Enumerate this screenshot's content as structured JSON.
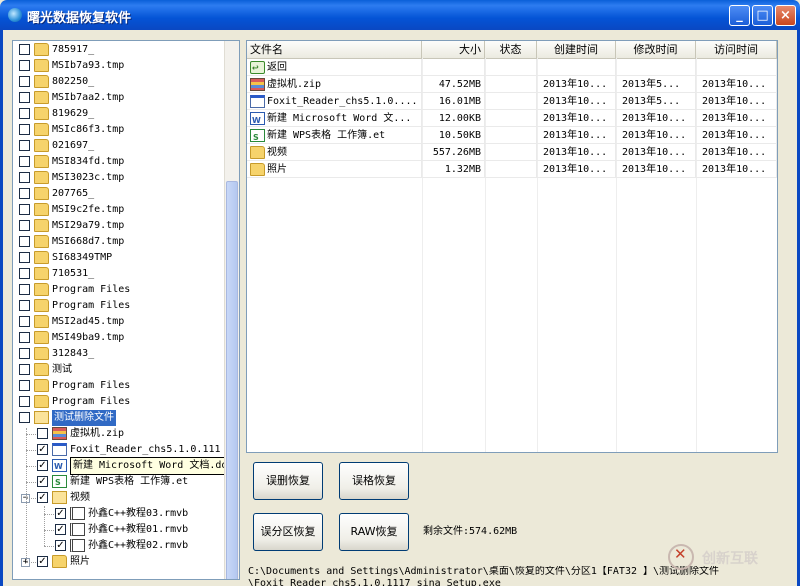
{
  "window": {
    "title": "曙光数据恢复软件"
  },
  "tree": {
    "items": [
      {
        "label": "785917_",
        "checked": false,
        "type": "folder",
        "level": 0
      },
      {
        "label": "MSIb7a93.tmp",
        "checked": false,
        "type": "folder",
        "level": 0
      },
      {
        "label": "802250_",
        "checked": false,
        "type": "folder",
        "level": 0
      },
      {
        "label": "MSIb7aa2.tmp",
        "checked": false,
        "type": "folder",
        "level": 0
      },
      {
        "label": "819629_",
        "checked": false,
        "type": "folder",
        "level": 0
      },
      {
        "label": "MSIc86f3.tmp",
        "checked": false,
        "type": "folder",
        "level": 0
      },
      {
        "label": "021697_",
        "checked": false,
        "type": "folder",
        "level": 0
      },
      {
        "label": "MSI834fd.tmp",
        "checked": false,
        "type": "folder",
        "level": 0
      },
      {
        "label": "MSI3023c.tmp",
        "checked": false,
        "type": "folder",
        "level": 0
      },
      {
        "label": "207765_",
        "checked": false,
        "type": "folder",
        "level": 0
      },
      {
        "label": "MSI9c2fe.tmp",
        "checked": false,
        "type": "folder",
        "level": 0
      },
      {
        "label": "MSI29a79.tmp",
        "checked": false,
        "type": "folder",
        "level": 0
      },
      {
        "label": "MSI668d7.tmp",
        "checked": false,
        "type": "folder",
        "level": 0
      },
      {
        "label": "SI68349TMP",
        "checked": false,
        "type": "folder",
        "level": 0
      },
      {
        "label": "710531_",
        "checked": false,
        "type": "folder",
        "level": 0
      },
      {
        "label": "Program Files",
        "checked": false,
        "type": "folder",
        "level": 0
      },
      {
        "label": "Program Files",
        "checked": false,
        "type": "folder",
        "level": 0
      },
      {
        "label": "MSI2ad45.tmp",
        "checked": false,
        "type": "folder",
        "level": 0
      },
      {
        "label": "MSI49ba9.tmp",
        "checked": false,
        "type": "folder",
        "level": 0
      },
      {
        "label": "312843_",
        "checked": false,
        "type": "folder",
        "level": 0
      },
      {
        "label": "测试",
        "checked": false,
        "type": "folder",
        "level": 0
      },
      {
        "label": "Program Files",
        "checked": false,
        "type": "folder",
        "level": 0
      },
      {
        "label": "Program Files",
        "checked": false,
        "type": "folder",
        "level": 0
      },
      {
        "label": "测试删除文件",
        "checked": false,
        "type": "folder-open",
        "level": 0,
        "selected": true
      },
      {
        "label": "虚拟机.zip",
        "checked": false,
        "type": "zip",
        "level": 1
      },
      {
        "label": "Foxit_Reader_chs5.1.0.111",
        "checked": true,
        "type": "exe",
        "level": 1
      },
      {
        "label": "新建 Microsoft Word 文档.doc",
        "checked": true,
        "type": "doc",
        "level": 1,
        "tooltip": true
      },
      {
        "label": "新建 WPS表格 工作簿.et",
        "checked": true,
        "type": "xls",
        "level": 1
      },
      {
        "label": "视频",
        "checked": true,
        "type": "folder-open",
        "level": 1,
        "expander": "−"
      },
      {
        "label": "孙鑫C++教程03.rmvb",
        "checked": true,
        "type": "rm",
        "level": 2
      },
      {
        "label": "孙鑫C++教程01.rmvb",
        "checked": true,
        "type": "rm",
        "level": 2
      },
      {
        "label": "孙鑫C++教程02.rmvb",
        "checked": true,
        "type": "rm",
        "level": 2
      },
      {
        "label": "照片",
        "checked": true,
        "type": "folder",
        "level": 1,
        "expander": "+"
      }
    ]
  },
  "list": {
    "columns": [
      "文件名",
      "大小",
      "状态",
      "创建时间",
      "修改时间",
      "访问时间"
    ],
    "rows": [
      {
        "icon": "back",
        "name": "返回",
        "size": "",
        "status": "",
        "created": "",
        "modified": "",
        "accessed": ""
      },
      {
        "icon": "zip",
        "name": "虚拟机.zip",
        "size": "47.52MB",
        "status": "",
        "created": "2013年10...",
        "modified": "2013年5...",
        "accessed": "2013年10..."
      },
      {
        "icon": "exe",
        "name": "Foxit_Reader_chs5.1.0....",
        "size": "16.01MB",
        "status": "",
        "created": "2013年10...",
        "modified": "2013年5...",
        "accessed": "2013年10..."
      },
      {
        "icon": "doc",
        "name": "新建 Microsoft Word 文...",
        "size": "12.00KB",
        "status": "",
        "created": "2013年10...",
        "modified": "2013年10...",
        "accessed": "2013年10..."
      },
      {
        "icon": "xls",
        "name": "新建 WPS表格 工作簿.et",
        "size": "10.50KB",
        "status": "",
        "created": "2013年10...",
        "modified": "2013年10...",
        "accessed": "2013年10..."
      },
      {
        "icon": "folder",
        "name": "视频",
        "size": "557.26MB",
        "status": "",
        "created": "2013年10...",
        "modified": "2013年10...",
        "accessed": "2013年10..."
      },
      {
        "icon": "folder",
        "name": "照片",
        "size": "1.32MB",
        "status": "",
        "created": "2013年10...",
        "modified": "2013年10...",
        "accessed": "2013年10..."
      }
    ]
  },
  "buttons": {
    "mistaken_delete": "误删恢复",
    "mistaken_format": "误格恢复",
    "mistaken_partition": "误分区恢复",
    "raw": "RAW恢复"
  },
  "remaining": "剩余文件:574.62MB",
  "status_path": {
    "line1": "C:\\Documents and Settings\\Administrator\\桌面\\恢复的文件\\分区1【FAT32 】\\测试删除文件",
    "line2": "\\Foxit_Reader_chs5.1.0.1117_sina_Setup.exe"
  },
  "watermark": "创新互联"
}
